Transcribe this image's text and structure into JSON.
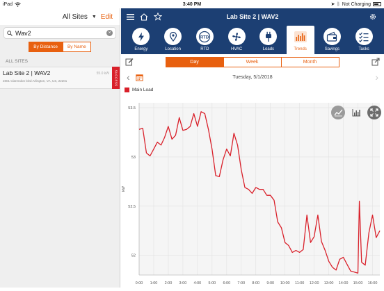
{
  "statusbar": {
    "device": "iPad",
    "time": "3:40 PM",
    "charging": "Not Charging"
  },
  "sidebar": {
    "sites_selector": "All Sites",
    "edit_label": "Edit",
    "search_value": "Wav2",
    "sort_by_distance": "By Distance",
    "sort_by_name": "By Name",
    "section_label": "ALL SITES",
    "site": {
      "name": "Lab Site 2 | WAV2",
      "address": "2801 Clarendon blvd Arlington, VA, US, 22201",
      "metric": "55.0 kW",
      "status": "SUCCESS"
    }
  },
  "header": {
    "title": "Lab Site 2 | WAV2"
  },
  "tabs": [
    {
      "label": "Energy",
      "icon": "bolt-icon"
    },
    {
      "label": "Location",
      "icon": "location-pin-icon"
    },
    {
      "label": "RTD",
      "icon": "rtd-icon"
    },
    {
      "label": "HVAC",
      "icon": "fan-icon"
    },
    {
      "label": "Loads",
      "icon": "plug-icon"
    },
    {
      "label": "Trends",
      "icon": "trends-icon"
    },
    {
      "label": "Savings",
      "icon": "savings-icon"
    },
    {
      "label": "Tasks",
      "icon": "tasks-icon"
    }
  ],
  "active_tab": "Trends",
  "period": {
    "day": "Day",
    "week": "Week",
    "month": "Month",
    "active": "Day"
  },
  "date_label": "Tuesday, 5/1/2018",
  "colors": {
    "accent": "#e8600f",
    "nav": "#1c3f73",
    "series": "#d9202a"
  },
  "chart_data": {
    "type": "line",
    "title": "",
    "xlabel": "",
    "ylabel": "kW",
    "ylim": [
      51.8,
      53.55
    ],
    "yticks": [
      52,
      52.5,
      53,
      53.5
    ],
    "ytick_labels": [
      "52",
      "52.5",
      "53",
      "53.5"
    ],
    "xticks": [
      "0:00",
      "1:00",
      "2:00",
      "3:00",
      "4:00",
      "5:00",
      "6:00",
      "7:00",
      "8:00",
      "9:00",
      "10:00",
      "11:00",
      "12:00",
      "13:00",
      "14:00",
      "15:00",
      "16:00"
    ],
    "grid": true,
    "legend": "top-left",
    "series": [
      {
        "name": "Main Load",
        "x": [
          0,
          0.25,
          0.5,
          0.75,
          1,
          1.25,
          1.5,
          1.75,
          2,
          2.25,
          2.5,
          2.75,
          3,
          3.25,
          3.5,
          3.75,
          4,
          4.25,
          4.5,
          4.75,
          5,
          5.25,
          5.5,
          5.75,
          6,
          6.25,
          6.5,
          6.75,
          7,
          7.25,
          7.5,
          7.75,
          8,
          8.25,
          8.5,
          8.75,
          9,
          9.25,
          9.5,
          9.75,
          10,
          10.25,
          10.5,
          10.75,
          11,
          11.25,
          11.5,
          11.75,
          12,
          12.25,
          12.5,
          12.75,
          13,
          13.25,
          13.5,
          13.75,
          14,
          14.25,
          14.5,
          14.75,
          15,
          15.1,
          15.25,
          15.5,
          15.75,
          16,
          16.25,
          16.5
        ],
        "values": [
          53.28,
          53.29,
          53.04,
          53.01,
          53.08,
          53.15,
          53.12,
          53.2,
          53.31,
          53.18,
          53.22,
          53.4,
          53.27,
          53.28,
          53.31,
          53.44,
          53.31,
          53.46,
          53.44,
          53.28,
          53.08,
          52.81,
          52.8,
          52.97,
          53.08,
          53.01,
          53.24,
          53.12,
          52.87,
          52.69,
          52.67,
          52.63,
          52.69,
          52.67,
          52.67,
          52.61,
          52.61,
          52.56,
          52.34,
          52.28,
          52.13,
          52.1,
          52.03,
          52.05,
          52.03,
          52.06,
          52.41,
          52.13,
          52.19,
          52.41,
          52.14,
          52.05,
          51.94,
          51.88,
          51.85,
          51.96,
          51.98,
          51.91,
          51.84,
          51.83,
          51.82,
          52.55,
          51.93,
          51.9,
          52.23,
          52.41,
          52.18,
          52.25
        ]
      }
    ]
  }
}
